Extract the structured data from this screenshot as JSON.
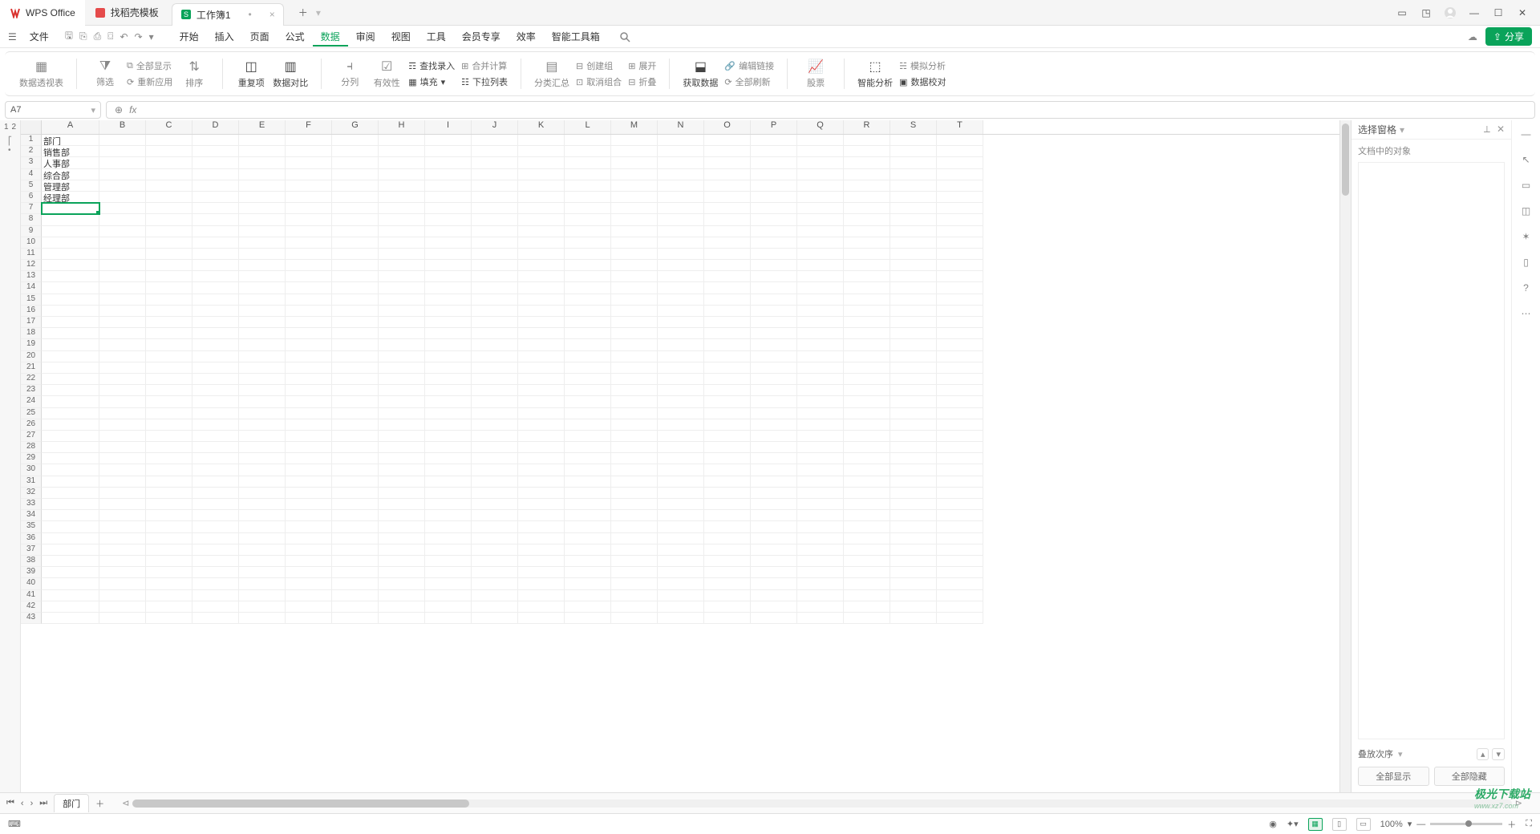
{
  "app": {
    "name": "WPS Office"
  },
  "tabs": {
    "template": "找稻壳模板",
    "doc": "工作簿1"
  },
  "menu": {
    "file": "文件",
    "items": [
      "开始",
      "插入",
      "页面",
      "公式",
      "数据",
      "审阅",
      "视图",
      "工具",
      "会员专享",
      "效率",
      "智能工具箱"
    ],
    "activeIndex": 4,
    "share": "分享"
  },
  "ribbon": {
    "pivot": "数据透视表",
    "filter": "筛选",
    "showAll": "全部显示",
    "reapply": "重新应用",
    "sort": "排序",
    "dup": "重复项",
    "compare": "数据对比",
    "split": "分列",
    "validity": "有效性",
    "findEntry": "查找录入",
    "consolidate": "合并计算",
    "fill": "填充",
    "dropdown": "下拉列表",
    "subtotal": "分类汇总",
    "group": "创建组",
    "ungroup": "取消组合",
    "expand": "展开",
    "collapse": "折叠",
    "getData": "获取数据",
    "editLinks": "编辑链接",
    "refreshAll": "全部刷新",
    "stocks": "股票",
    "smart": "智能分析",
    "verify": "数据校对",
    "sim": "模拟分析"
  },
  "nameBox": "A7",
  "columns": [
    "A",
    "B",
    "C",
    "D",
    "E",
    "F",
    "G",
    "H",
    "I",
    "J",
    "K",
    "L",
    "M",
    "N",
    "O",
    "P",
    "Q",
    "R",
    "S",
    "T"
  ],
  "rowCount": 43,
  "cells": {
    "A1": "部门",
    "A2": "销售部",
    "A3": "人事部",
    "A4": "综合部",
    "A5": "管理部",
    "A6": "经理部"
  },
  "selectedCell": "A7",
  "rightPanel": {
    "title": "选择窗格",
    "sub": "文档中的对象",
    "stack": "叠放次序",
    "showAll": "全部显示",
    "hideAll": "全部隐藏"
  },
  "sheet": {
    "name": "部门"
  },
  "status": {
    "zoom": "100%"
  },
  "leftRail": {
    "d1": "1",
    "d2": "2"
  },
  "watermark": {
    "brand": "极光下载站",
    "url": "www.xz7.com"
  }
}
